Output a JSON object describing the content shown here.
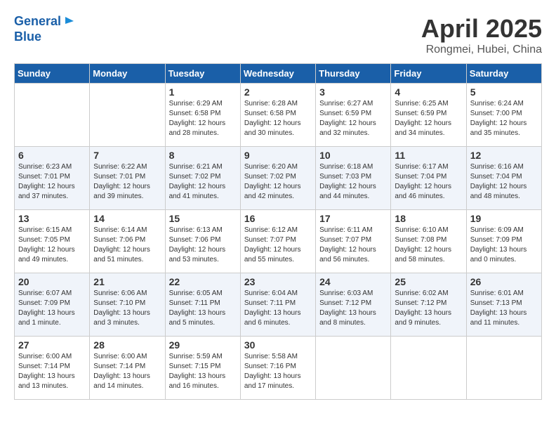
{
  "header": {
    "logo_line1": "General",
    "logo_line2": "Blue",
    "month": "April 2025",
    "location": "Rongmei, Hubei, China"
  },
  "weekdays": [
    "Sunday",
    "Monday",
    "Tuesday",
    "Wednesday",
    "Thursday",
    "Friday",
    "Saturday"
  ],
  "weeks": [
    [
      {
        "day": "",
        "info": ""
      },
      {
        "day": "",
        "info": ""
      },
      {
        "day": "1",
        "info": "Sunrise: 6:29 AM\nSunset: 6:58 PM\nDaylight: 12 hours\nand 28 minutes."
      },
      {
        "day": "2",
        "info": "Sunrise: 6:28 AM\nSunset: 6:58 PM\nDaylight: 12 hours\nand 30 minutes."
      },
      {
        "day": "3",
        "info": "Sunrise: 6:27 AM\nSunset: 6:59 PM\nDaylight: 12 hours\nand 32 minutes."
      },
      {
        "day": "4",
        "info": "Sunrise: 6:25 AM\nSunset: 6:59 PM\nDaylight: 12 hours\nand 34 minutes."
      },
      {
        "day": "5",
        "info": "Sunrise: 6:24 AM\nSunset: 7:00 PM\nDaylight: 12 hours\nand 35 minutes."
      }
    ],
    [
      {
        "day": "6",
        "info": "Sunrise: 6:23 AM\nSunset: 7:01 PM\nDaylight: 12 hours\nand 37 minutes."
      },
      {
        "day": "7",
        "info": "Sunrise: 6:22 AM\nSunset: 7:01 PM\nDaylight: 12 hours\nand 39 minutes."
      },
      {
        "day": "8",
        "info": "Sunrise: 6:21 AM\nSunset: 7:02 PM\nDaylight: 12 hours\nand 41 minutes."
      },
      {
        "day": "9",
        "info": "Sunrise: 6:20 AM\nSunset: 7:02 PM\nDaylight: 12 hours\nand 42 minutes."
      },
      {
        "day": "10",
        "info": "Sunrise: 6:18 AM\nSunset: 7:03 PM\nDaylight: 12 hours\nand 44 minutes."
      },
      {
        "day": "11",
        "info": "Sunrise: 6:17 AM\nSunset: 7:04 PM\nDaylight: 12 hours\nand 46 minutes."
      },
      {
        "day": "12",
        "info": "Sunrise: 6:16 AM\nSunset: 7:04 PM\nDaylight: 12 hours\nand 48 minutes."
      }
    ],
    [
      {
        "day": "13",
        "info": "Sunrise: 6:15 AM\nSunset: 7:05 PM\nDaylight: 12 hours\nand 49 minutes."
      },
      {
        "day": "14",
        "info": "Sunrise: 6:14 AM\nSunset: 7:06 PM\nDaylight: 12 hours\nand 51 minutes."
      },
      {
        "day": "15",
        "info": "Sunrise: 6:13 AM\nSunset: 7:06 PM\nDaylight: 12 hours\nand 53 minutes."
      },
      {
        "day": "16",
        "info": "Sunrise: 6:12 AM\nSunset: 7:07 PM\nDaylight: 12 hours\nand 55 minutes."
      },
      {
        "day": "17",
        "info": "Sunrise: 6:11 AM\nSunset: 7:07 PM\nDaylight: 12 hours\nand 56 minutes."
      },
      {
        "day": "18",
        "info": "Sunrise: 6:10 AM\nSunset: 7:08 PM\nDaylight: 12 hours\nand 58 minutes."
      },
      {
        "day": "19",
        "info": "Sunrise: 6:09 AM\nSunset: 7:09 PM\nDaylight: 13 hours\nand 0 minutes."
      }
    ],
    [
      {
        "day": "20",
        "info": "Sunrise: 6:07 AM\nSunset: 7:09 PM\nDaylight: 13 hours\nand 1 minute."
      },
      {
        "day": "21",
        "info": "Sunrise: 6:06 AM\nSunset: 7:10 PM\nDaylight: 13 hours\nand 3 minutes."
      },
      {
        "day": "22",
        "info": "Sunrise: 6:05 AM\nSunset: 7:11 PM\nDaylight: 13 hours\nand 5 minutes."
      },
      {
        "day": "23",
        "info": "Sunrise: 6:04 AM\nSunset: 7:11 PM\nDaylight: 13 hours\nand 6 minutes."
      },
      {
        "day": "24",
        "info": "Sunrise: 6:03 AM\nSunset: 7:12 PM\nDaylight: 13 hours\nand 8 minutes."
      },
      {
        "day": "25",
        "info": "Sunrise: 6:02 AM\nSunset: 7:12 PM\nDaylight: 13 hours\nand 9 minutes."
      },
      {
        "day": "26",
        "info": "Sunrise: 6:01 AM\nSunset: 7:13 PM\nDaylight: 13 hours\nand 11 minutes."
      }
    ],
    [
      {
        "day": "27",
        "info": "Sunrise: 6:00 AM\nSunset: 7:14 PM\nDaylight: 13 hours\nand 13 minutes."
      },
      {
        "day": "28",
        "info": "Sunrise: 6:00 AM\nSunset: 7:14 PM\nDaylight: 13 hours\nand 14 minutes."
      },
      {
        "day": "29",
        "info": "Sunrise: 5:59 AM\nSunset: 7:15 PM\nDaylight: 13 hours\nand 16 minutes."
      },
      {
        "day": "30",
        "info": "Sunrise: 5:58 AM\nSunset: 7:16 PM\nDaylight: 13 hours\nand 17 minutes."
      },
      {
        "day": "",
        "info": ""
      },
      {
        "day": "",
        "info": ""
      },
      {
        "day": "",
        "info": ""
      }
    ]
  ]
}
